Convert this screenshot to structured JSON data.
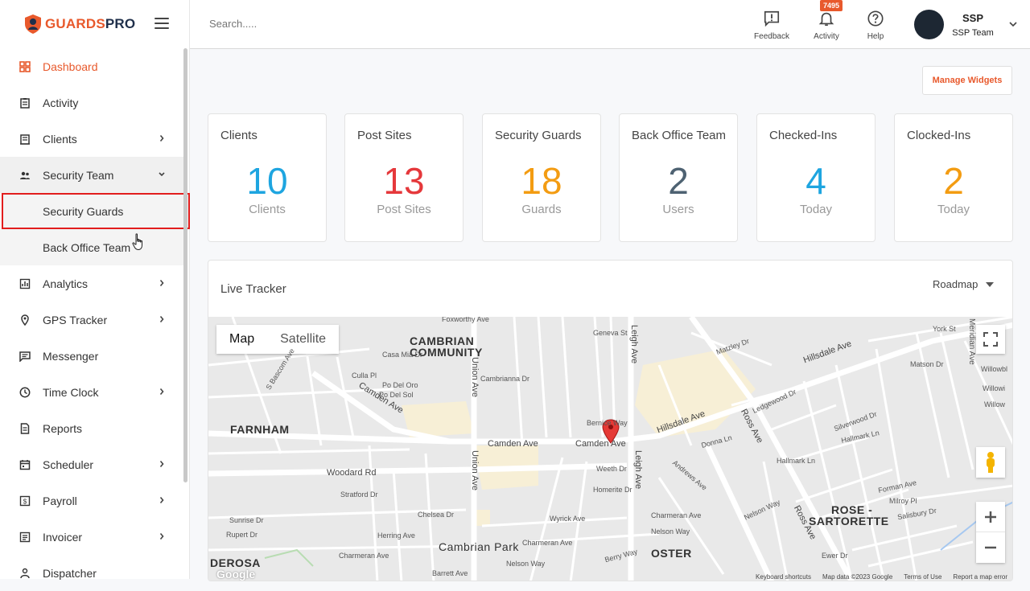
{
  "brand": {
    "name_part1": "GUARDS",
    "name_part2": "PRO"
  },
  "sidebar": {
    "items": [
      {
        "label": "Dashboard",
        "icon": "dashboard-icon",
        "active": true,
        "chevron": false
      },
      {
        "label": "Activity",
        "icon": "clipboard-icon",
        "chevron": false
      },
      {
        "label": "Clients",
        "icon": "building-icon",
        "chevron": true
      },
      {
        "label": "Security Team",
        "icon": "people-icon",
        "chevron": true,
        "open": true
      },
      {
        "label": "Security Guards",
        "sub": true,
        "highlight": true
      },
      {
        "label": "Back Office Team",
        "sub": true
      },
      {
        "label": "Analytics",
        "icon": "chart-icon",
        "chevron": true
      },
      {
        "label": "GPS Tracker",
        "icon": "location-pin-icon",
        "chevron": true
      },
      {
        "label": "Messenger",
        "icon": "message-icon",
        "chevron": false
      },
      {
        "label": "Time Clock",
        "icon": "clock-icon",
        "chevron": true
      },
      {
        "label": "Reports",
        "icon": "document-icon",
        "chevron": false
      },
      {
        "label": "Scheduler",
        "icon": "calendar-icon",
        "chevron": true
      },
      {
        "label": "Payroll",
        "icon": "payroll-icon",
        "chevron": true
      },
      {
        "label": "Invoicer",
        "icon": "invoice-icon",
        "chevron": true
      },
      {
        "label": "Dispatcher",
        "icon": "dispatcher-icon",
        "chevron": false
      }
    ]
  },
  "topbar": {
    "search_placeholder": "Search.....",
    "feedback_label": "Feedback",
    "activity_label": "Activity",
    "activity_badge": "7495",
    "help_label": "Help",
    "user_name": "SSP",
    "user_team": "SSP Team"
  },
  "main": {
    "manage_widgets": "Manage Widgets",
    "cards": [
      {
        "title": "Clients",
        "value": "10",
        "sub": "Clients",
        "color": "#1ea5e0"
      },
      {
        "title": "Post Sites",
        "value": "13",
        "sub": "Post Sites",
        "color": "#e5383b"
      },
      {
        "title": "Security Guards",
        "value": "18",
        "sub": "Guards",
        "color": "#f39c12"
      },
      {
        "title": "Back Office Team",
        "value": "2",
        "sub": "Users",
        "color": "#4e6272"
      },
      {
        "title": "Checked-Ins",
        "value": "4",
        "sub": "Today",
        "color": "#1ea5e0"
      },
      {
        "title": "Clocked-Ins",
        "value": "2",
        "sub": "Today",
        "color": "#f39c12"
      }
    ],
    "tracker": {
      "title": "Live Tracker",
      "map_type": "Roadmap",
      "tab_map": "Map",
      "tab_satellite": "Satellite",
      "labels": {
        "cambrian_community_1": "CAMBRIAN",
        "cambrian_community_2": "COMMUNITY",
        "farnham": "FARNHAM",
        "cambrian_park": "Cambrian Park",
        "rose_sartorette_1": "ROSE -",
        "rose_sartorette_2": "SARTORETTE",
        "derosa": "DEROSA",
        "oster": "OSTER",
        "camden_ave_1": "Camden Ave",
        "camden_ave_2": "Camden Ave",
        "camden_ave_diag": "Camden Ave",
        "hillsdale_ave_1": "Hillsdale Ave",
        "hillsdale_ave_2": "Hillsdale Ave",
        "union_ave_1": "Union Ave",
        "union_ave_2": "Union Ave",
        "leigh_ave_1": "Leigh Ave",
        "leigh_ave_2": "Leigh Ave",
        "ross_ave_1": "Ross Ave",
        "ross_ave_2": "Ross Ave",
        "woodard_rd": "Woodard Rd",
        "s_bascom_ave": "S Bascom Ave",
        "foxworthy_ave": "Foxworthy Ave",
        "geneva_st": "Geneva St",
        "casa_mia_dr": "Casa Mia Dr",
        "cambrianna_dr": "Cambrianna Dr",
        "po_del_oro": "Po Del Oro",
        "po_del_sol": "Po Del Sol",
        "culla_pl": "Culla Pl",
        "weeth_dr": "Weeth Dr",
        "homerite_dr": "Homerite Dr",
        "wyrick_ave": "Wyrick Ave",
        "charmeran_ave_1": "Charmeran Ave",
        "charmeran_ave_2": "Charmeran Ave",
        "charmeran_ave_3": "Charmeran Ave",
        "nelson_way_1": "Nelson Way",
        "nelson_way_2": "Nelson Way",
        "nelson_way_3": "Nelson Way",
        "berry_way": "Berry Way",
        "stratford_dr": "Stratford Dr",
        "chelsea_dr": "Chelsea Dr",
        "herring_ave": "Herring Ave",
        "sunrise_dr": "Sunrise Dr",
        "rupert_dr": "Rupert Dr",
        "barrett_ave": "Barrett Ave",
        "hallmark_ln_1": "Hallmark Ln",
        "hallmark_ln_2": "Hallmark Ln",
        "silverwood_dr": "Silverwood Dr",
        "forman_ave": "Forman Ave",
        "milroy_pl": "Milroy Pl",
        "salisbury_dr": "Salisbury Dr",
        "matson_dr": "Matson Dr",
        "york_st": "York St",
        "matzley_dr": "Matzley Dr",
        "donna_ln": "Donna Ln",
        "ledgewood_dr": "Ledgewood Dr",
        "andrews_ave": "Andrews Ave",
        "ewer_dr": "Ewer Dr",
        "meridian_ave": "Meridian Ave",
        "willowbrook": "Willowbl",
        "willowhaven": "Willowi",
        "willowmont": "Willow",
        "bernice_way": "Bernice Way"
      },
      "footer": {
        "keyboard": "Keyboard shortcuts",
        "map_data": "Map data ©2023 Google",
        "terms": "Terms of Use",
        "report": "Report a map error"
      },
      "google_logo": "Google"
    }
  },
  "colors": {
    "accent": "#e8592c",
    "highlight_border": "#e21d1d"
  }
}
